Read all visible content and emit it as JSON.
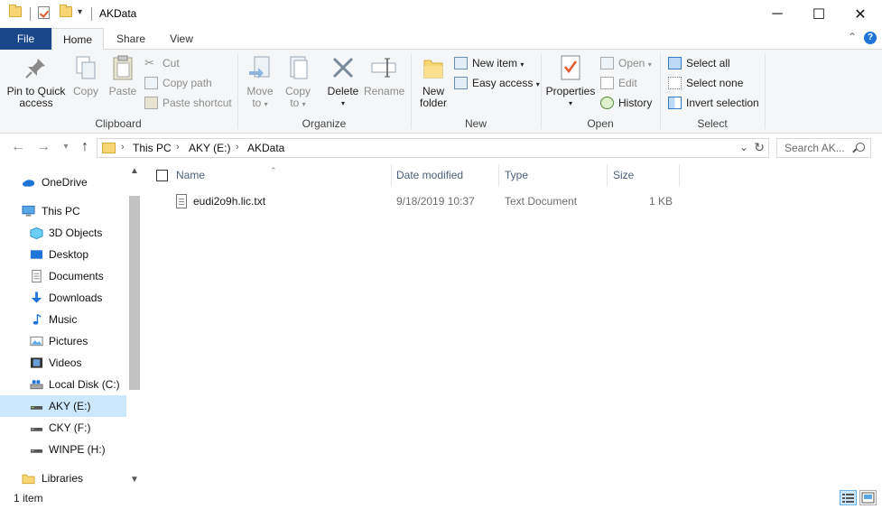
{
  "window": {
    "title": "AKData",
    "controls": {
      "minimize": "─",
      "maximize": "☐",
      "close": "✕"
    }
  },
  "ribbon_tabs": [
    {
      "label": "File"
    },
    {
      "label": "Home"
    },
    {
      "label": "Share"
    },
    {
      "label": "View"
    }
  ],
  "ribbon": {
    "clipboard": {
      "group": "Clipboard",
      "pin_line1": "Pin to Quick",
      "pin_line2": "access",
      "copy": "Copy",
      "paste": "Paste",
      "cut": "Cut",
      "copy_path": "Copy path",
      "paste_shortcut": "Paste shortcut"
    },
    "organize": {
      "group": "Organize",
      "move_to_line1": "Move",
      "move_to_line2": "to",
      "copy_to_line1": "Copy",
      "copy_to_line2": "to",
      "delete": "Delete",
      "rename": "Rename"
    },
    "new": {
      "group": "New",
      "new_folder_line1": "New",
      "new_folder_line2": "folder",
      "new_item": "New item",
      "easy_access": "Easy access"
    },
    "open": {
      "group": "Open",
      "properties": "Properties",
      "open": "Open",
      "edit": "Edit",
      "history": "History"
    },
    "select": {
      "group": "Select",
      "select_all": "Select all",
      "select_none": "Select none",
      "invert_selection": "Invert selection"
    }
  },
  "address": {
    "crumbs": [
      "This PC",
      "AKY (E:)",
      "AKData"
    ],
    "search_placeholder": "Search AK..."
  },
  "nav": {
    "items": [
      {
        "label": "OneDrive",
        "icon": "cloud-icon"
      },
      {
        "label": "This PC",
        "icon": "computer-icon"
      },
      {
        "label": "3D Objects",
        "icon": "cube-icon"
      },
      {
        "label": "Desktop",
        "icon": "desktop-icon"
      },
      {
        "label": "Documents",
        "icon": "documents-icon"
      },
      {
        "label": "Downloads",
        "icon": "download-icon"
      },
      {
        "label": "Music",
        "icon": "music-icon"
      },
      {
        "label": "Pictures",
        "icon": "pictures-icon"
      },
      {
        "label": "Videos",
        "icon": "videos-icon"
      },
      {
        "label": "Local Disk (C:)",
        "icon": "drive-icon"
      },
      {
        "label": "AKY (E:)",
        "icon": "drive-icon"
      },
      {
        "label": "CKY (F:)",
        "icon": "drive-icon"
      },
      {
        "label": "WINPE (H:)",
        "icon": "drive-icon"
      },
      {
        "label": "Libraries",
        "icon": "libraries-icon"
      }
    ],
    "selected": "AKY (E:)"
  },
  "columns": {
    "name": "Name",
    "date": "Date modified",
    "type": "Type",
    "size": "Size"
  },
  "files": [
    {
      "name": "eudi2o9h.lic.txt",
      "date": "9/18/2019 10:37",
      "type": "Text Document",
      "size": "1 KB"
    }
  ],
  "status": {
    "count": "1 item"
  },
  "colors": {
    "file_tab": "#19478a",
    "selection": "#cce8ff",
    "accent": "#1e74d8"
  }
}
